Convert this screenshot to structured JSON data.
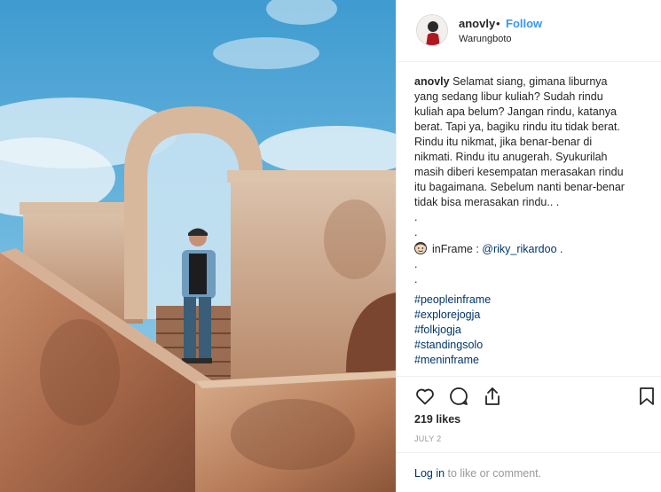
{
  "post": {
    "username": "anovly",
    "separator": "•",
    "follow_label": "Follow",
    "location": "Warungboto"
  },
  "caption": {
    "user": "anovly",
    "lines": [
      "Selamat siang, gimana liburnya",
      "yang sedang libur kuliah? Sudah rindu",
      "kuliah apa belum? Jangan rindu, katanya",
      "berat. Tapi ya, bagiku rindu itu tidak berat.",
      "Rindu itu nikmat, jika benar-benar di",
      "nikmati. Rindu itu anugerah. Syukurilah",
      "masih diberi kesempatan merasakan rindu",
      "itu bagaimana. Sebelum nanti benar-benar",
      "tidak bisa merasakan rindu.. ."
    ],
    "first_line": "Selamat siang, gimana liburnya",
    "dot_lines": [
      ".",
      "."
    ],
    "inframe_label": "inFrame :",
    "mention": "@riky_rikardoo",
    "mention_suffix": ".",
    "dot_lines_2": [
      ".",
      "."
    ],
    "hashtags": [
      "#peopleinframe",
      "#explorejogja",
      "#folkjogja",
      "#standingsolo",
      "#meninframe"
    ]
  },
  "icons": {
    "like": "heart-icon",
    "comment": "comment-icon",
    "share": "share-icon",
    "save": "bookmark-icon",
    "inframe": "face-emoji-icon"
  },
  "stats": {
    "likes": "219 likes",
    "date": "JULY 2"
  },
  "login": {
    "link": "Log in",
    "rest": " to like or comment."
  },
  "colors": {
    "link": "#003569",
    "follow": "#3897f0",
    "muted": "#999999",
    "divider": "#efefef"
  }
}
